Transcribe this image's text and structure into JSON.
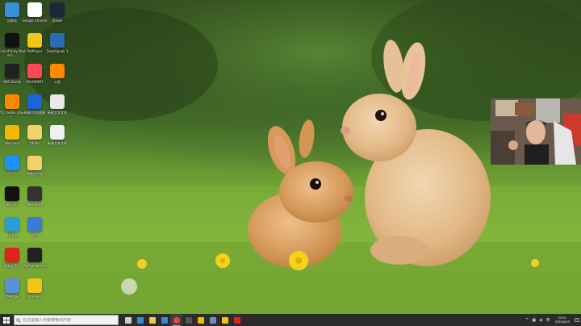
{
  "desktop": {
    "icons": [
      {
        "label": "回收站",
        "glyph": "recycle-bin-icon",
        "color": "#3a8fd9"
      },
      {
        "label": "Google Chrome",
        "glyph": "chrome-icon",
        "color": "#ffffff"
      },
      {
        "label": "Steam",
        "glyph": "steam-icon",
        "color": "#1b2838"
      },
      {
        "label": "Call of Duty Modern ...",
        "glyph": "cod-icon",
        "color": "#111111"
      },
      {
        "label": "PotPlayer",
        "glyph": "potplayer-icon",
        "color": "#f0c419"
      },
      {
        "label": "TeamSpeak 3",
        "glyph": "teamspeak-icon",
        "color": "#2a6db5"
      },
      {
        "label": "OBS Studio",
        "glyph": "obs-icon",
        "color": "#222222"
      },
      {
        "label": "VALORANT",
        "glyph": "valorant-icon",
        "color": "#ff4655"
      },
      {
        "label": "斗鱼",
        "glyph": "douyu-icon",
        "color": "#ff8a00"
      },
      {
        "label": "VLC media player",
        "glyph": "vlc-icon",
        "color": "#ff8800"
      },
      {
        "label": "网易UU加速器",
        "glyph": "uu-icon",
        "color": "#1c64d8"
      },
      {
        "label": "新建文本文档",
        "glyph": "text-doc-icon",
        "color": "#e8e8e8"
      },
      {
        "label": "WeGame",
        "glyph": "wegame-icon",
        "color": "#f5b800"
      },
      {
        "label": "DEMO",
        "glyph": "folder-icon",
        "color": "#f2d36b"
      },
      {
        "label": "新建文本文档",
        "glyph": "text-doc-icon",
        "color": "#f0f0f0"
      },
      {
        "label": "YY",
        "glyph": "yy-icon",
        "color": "#1e90ff"
      },
      {
        "label": "新建文件夹",
        "glyph": "folder-icon",
        "color": "#f2d36b"
      },
      {
        "label": "腾讯QQ",
        "glyph": "qq-icon",
        "color": "#111111"
      },
      {
        "label": "WeGame版",
        "glyph": "wegame-icon",
        "color": "#333333"
      },
      {
        "label": "Uplay",
        "glyph": "uplay-icon",
        "color": "#2a9fd6"
      },
      {
        "label": "Ultra",
        "glyph": "window-icon",
        "color": "#3a7bd5"
      },
      {
        "label": "网易云音乐",
        "glyph": "netease-music-icon",
        "color": "#e2231a"
      },
      {
        "label": "Apex Legends",
        "glyph": "apex-icon",
        "color": "#222222"
      },
      {
        "label": "控制面板",
        "glyph": "control-panel-icon",
        "color": "#5b8fd6"
      },
      {
        "label": "PotPlayer",
        "glyph": "potplayer-icon",
        "color": "#f0c419"
      }
    ]
  },
  "taskbar": {
    "search_placeholder": "在这里输入你要搜索的内容",
    "apps": [
      {
        "name": "task-view",
        "color": "#cfcfcf"
      },
      {
        "name": "edge",
        "color": "#2f8de0"
      },
      {
        "name": "file-explorer",
        "color": "#f3c552"
      },
      {
        "name": "store",
        "color": "#3b88d6"
      },
      {
        "name": "chrome",
        "color": "#e8453c"
      },
      {
        "name": "obs",
        "color": "#555555"
      },
      {
        "name": "wegame",
        "color": "#f5b800"
      },
      {
        "name": "steam",
        "color": "#6b8fb4"
      },
      {
        "name": "potplayer",
        "color": "#f0c419"
      },
      {
        "name": "netease-music",
        "color": "#e2231a"
      }
    ],
    "tray": {
      "chevron": "^",
      "lang": "中"
    },
    "clock": {
      "time": "22:01",
      "date": "2020/4/13"
    }
  },
  "colors": {
    "taskbar": "#2b2b2b",
    "accent": "#76b9ed"
  }
}
